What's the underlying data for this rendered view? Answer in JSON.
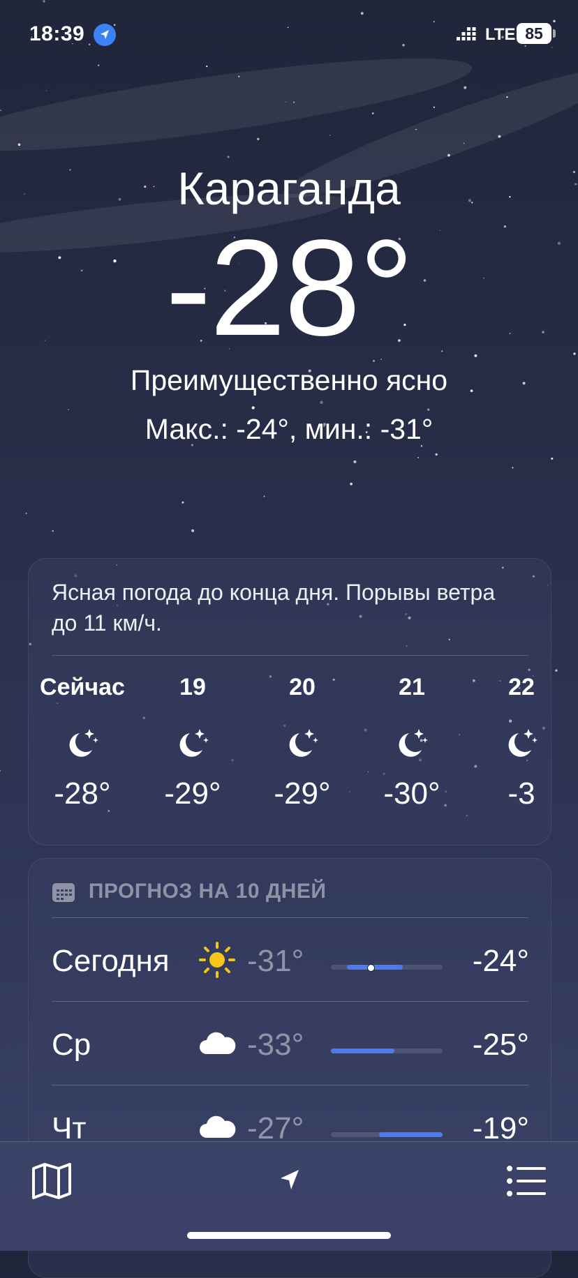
{
  "status_bar": {
    "time": "18:39",
    "network": "LTE",
    "battery": "85"
  },
  "weather": {
    "city": "Караганда",
    "temperature": "-28°",
    "condition": "Преимущественно ясно",
    "hi_lo": "Макс.: -24°, мин.: -31°"
  },
  "hourly": {
    "summary": "Ясная погода до конца дня. Порывы ветра до 11 км/ч.",
    "items": [
      {
        "label": "Сейчас",
        "icon": "moon-stars-icon",
        "temp": "-28°"
      },
      {
        "label": "19",
        "icon": "moon-stars-icon",
        "temp": "-29°"
      },
      {
        "label": "20",
        "icon": "moon-stars-icon",
        "temp": "-29°"
      },
      {
        "label": "21",
        "icon": "moon-stars-icon",
        "temp": "-30°"
      },
      {
        "label": "22",
        "icon": "moon-stars-icon",
        "temp": "-3"
      }
    ]
  },
  "daily": {
    "title": "ПРОГНОЗ НА 10 ДНЕЙ",
    "range_min": -33,
    "range_max": -19,
    "days": [
      {
        "name": "Сегодня",
        "icon": "sun-icon",
        "low": "-31°",
        "high": "-24°",
        "low_value": -31,
        "high_value": -24,
        "current_value": -28
      },
      {
        "name": "Ср",
        "icon": "cloud-icon",
        "low": "-33°",
        "high": "-25°",
        "low_value": -33,
        "high_value": -25
      },
      {
        "name": "Чт",
        "icon": "cloud-icon",
        "low": "-27°",
        "high": "-19°",
        "low_value": -27,
        "high_value": -19
      }
    ]
  },
  "colors": {
    "accent": "#4a7cf0",
    "sun": "#f5c518",
    "location": "#3b82f6"
  },
  "toolbar": {
    "icons": [
      "map-icon",
      "location-arrow-icon",
      "list-icon"
    ]
  }
}
